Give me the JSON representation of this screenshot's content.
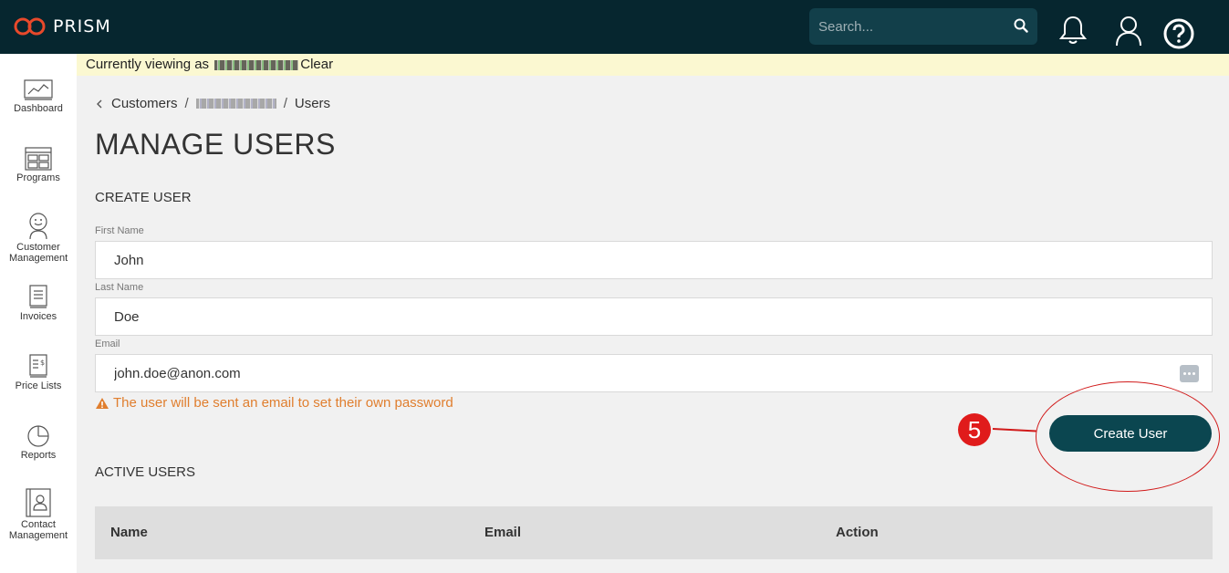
{
  "app": {
    "name": "PRISM"
  },
  "header": {
    "search_placeholder": "Search...",
    "icons": [
      "bell-icon",
      "user-icon",
      "help-icon"
    ]
  },
  "sidebar": {
    "items": [
      {
        "label": "Dashboard",
        "icon": "chart-icon"
      },
      {
        "label": "Programs",
        "icon": "grid-icon"
      },
      {
        "label": "Customer Management",
        "icon": "smiley-icon"
      },
      {
        "label": "Invoices",
        "icon": "document-icon"
      },
      {
        "label": "Price Lists",
        "icon": "pricelist-icon"
      },
      {
        "label": "Reports",
        "icon": "pie-icon"
      },
      {
        "label": "Contact Management",
        "icon": "contact-book-icon"
      }
    ]
  },
  "banner": {
    "prefix": "Currently viewing as",
    "clear": "Clear"
  },
  "breadcrumb": {
    "customers": "Customers",
    "sep": "/",
    "users": "Users"
  },
  "page": {
    "title": "MANAGE USERS"
  },
  "create_user": {
    "section_title": "CREATE USER",
    "first_name_label": "First Name",
    "first_name_value": "John",
    "last_name_label": "Last Name",
    "last_name_value": "Doe",
    "email_label": "Email",
    "email_value": "john.doe@anon.com",
    "warning": "The user will be sent an email to set their own password",
    "button": "Create User"
  },
  "annotation": {
    "step": "5",
    "color": "#d11a1a"
  },
  "active_users": {
    "section_title": "ACTIVE USERS",
    "columns": [
      "Name",
      "Email",
      "Action"
    ]
  },
  "colors": {
    "topbar": "#06262f",
    "accent": "#0b4650",
    "warning": "#e07e2e",
    "logo": "#e8492b"
  }
}
